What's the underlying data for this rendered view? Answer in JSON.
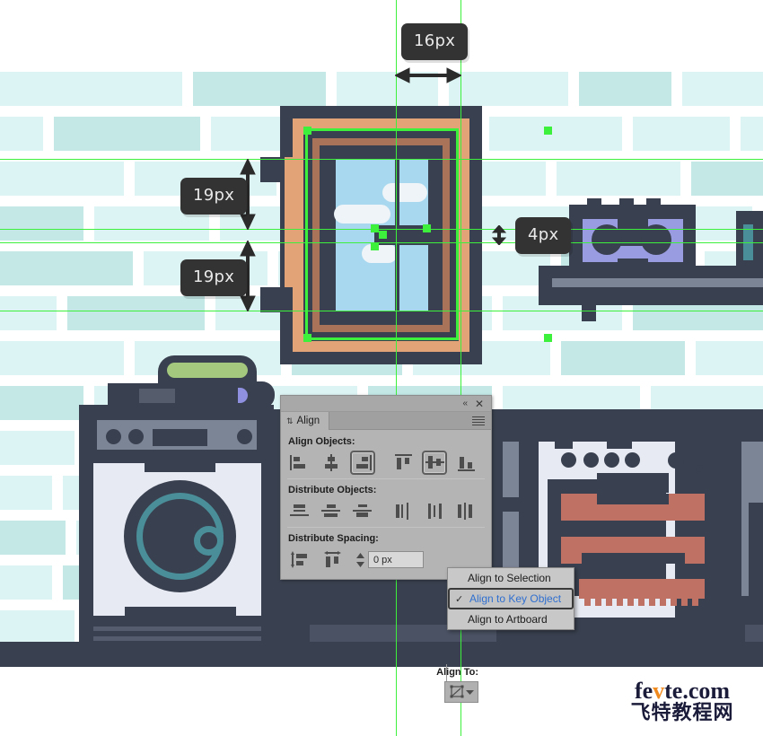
{
  "app": {
    "illustration": "bathroom-laundry-flat-illustration"
  },
  "measurements": [
    {
      "id": "m-16",
      "label": "16px",
      "orientation": "horizontal"
    },
    {
      "id": "m-19a",
      "label": "19px",
      "orientation": "vertical"
    },
    {
      "id": "m-19b",
      "label": "19px",
      "orientation": "vertical"
    },
    {
      "id": "m-4",
      "label": "4px",
      "orientation": "vertical"
    }
  ],
  "panel": {
    "title": "Align",
    "collapse_icon": "«",
    "close_icon": "✕",
    "sections": {
      "align_objects": "Align Objects:",
      "distribute_objects": "Distribute Objects:",
      "distribute_spacing": "Distribute Spacing:",
      "align_to": "Align To:"
    },
    "align_buttons": [
      {
        "name": "horizontal-align-left",
        "pressed": false
      },
      {
        "name": "horizontal-align-center",
        "pressed": false
      },
      {
        "name": "horizontal-align-right",
        "pressed": true
      },
      {
        "name": "vertical-align-top",
        "pressed": false
      },
      {
        "name": "vertical-align-center",
        "pressed": true
      },
      {
        "name": "vertical-align-bottom",
        "pressed": false
      }
    ],
    "distribute_buttons": [
      {
        "name": "vertical-distribute-top"
      },
      {
        "name": "vertical-distribute-center"
      },
      {
        "name": "vertical-distribute-bottom"
      },
      {
        "name": "horizontal-distribute-left"
      },
      {
        "name": "horizontal-distribute-center"
      },
      {
        "name": "horizontal-distribute-right"
      }
    ],
    "spacing_buttons": [
      {
        "name": "vertical-distribute-space"
      },
      {
        "name": "horizontal-distribute-space"
      }
    ],
    "spacing_value": "0 px"
  },
  "dropdown": {
    "items": [
      {
        "label": "Align to Selection",
        "selected": false
      },
      {
        "label": "Align to Key Object",
        "selected": true
      },
      {
        "label": "Align to Artboard",
        "selected": false
      }
    ],
    "check_glyph": "✓"
  },
  "watermark": {
    "line1_a": "fe",
    "line1_v": "v",
    "line1_b": "te.com",
    "line2": "飞特教程网"
  },
  "colors": {
    "guide_green": "#3cf03c",
    "dark_navy": "#39404f",
    "tan": "#e2a477",
    "glass_blue": "#a7d8ef",
    "brick_light": "#ddf4f4",
    "brick_mid": "#c3e8e6",
    "teal": "#4a8e99",
    "terracotta": "#bf7163",
    "purple": "#9a9ce2",
    "green_towel": "#a4c87e",
    "purple_towel": "#8f90e0",
    "highlight_blue": "#2f6fd0"
  }
}
